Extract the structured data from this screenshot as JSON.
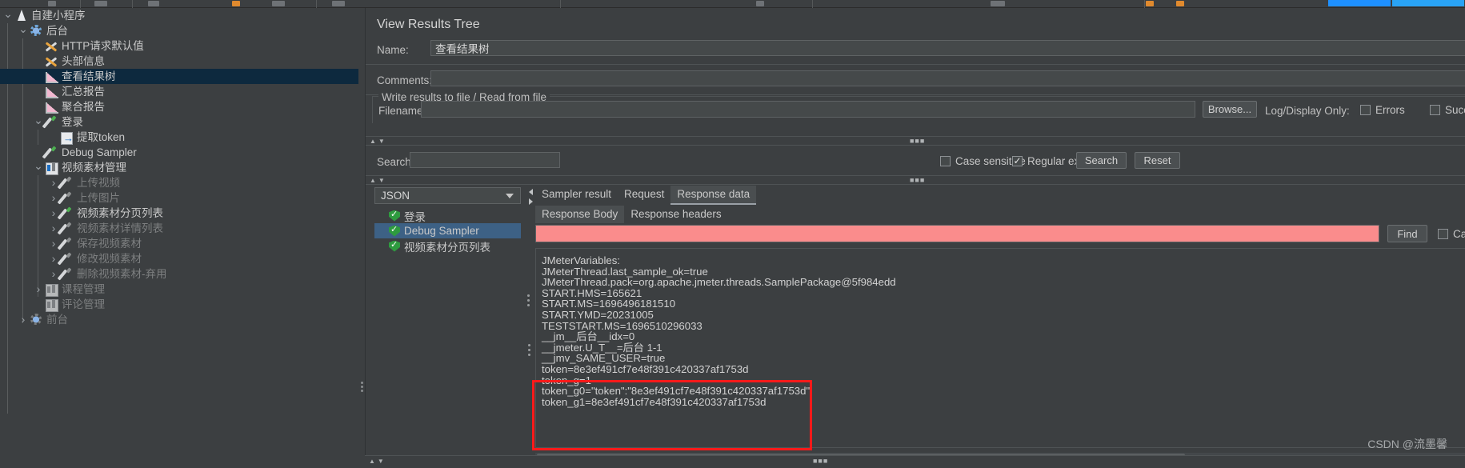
{
  "app": {
    "watermark": "CSDN @流墨馨"
  },
  "tree": {
    "items": [
      {
        "label": "自建小程序",
        "icon": "flask-icon",
        "depth": 0,
        "twisty": "open",
        "selected": false,
        "disabled": false
      },
      {
        "label": "后台",
        "icon": "gear-icon",
        "depth": 1,
        "twisty": "open",
        "selected": false,
        "disabled": false
      },
      {
        "label": "HTTP请求默认值",
        "icon": "wrench-icon",
        "depth": 2,
        "twisty": "none",
        "selected": false,
        "disabled": false
      },
      {
        "label": "头部信息",
        "icon": "wrench-icon",
        "depth": 2,
        "twisty": "none",
        "selected": false,
        "disabled": false
      },
      {
        "label": "查看结果树",
        "icon": "chart-icon",
        "depth": 2,
        "twisty": "none",
        "selected": true,
        "disabled": false
      },
      {
        "label": "汇总报告",
        "icon": "chart-icon",
        "depth": 2,
        "twisty": "none",
        "selected": false,
        "disabled": false
      },
      {
        "label": "聚合报告",
        "icon": "chart-icon",
        "depth": 2,
        "twisty": "none",
        "selected": false,
        "disabled": false
      },
      {
        "label": "登录",
        "icon": "sampler-pen-icon",
        "depth": 2,
        "twisty": "open",
        "selected": false,
        "disabled": false
      },
      {
        "label": "提取token",
        "icon": "post-processor-icon",
        "depth": 3,
        "twisty": "none",
        "selected": false,
        "disabled": false
      },
      {
        "label": "Debug Sampler",
        "icon": "sampler-pen-icon",
        "depth": 2,
        "twisty": "none",
        "selected": false,
        "disabled": false
      },
      {
        "label": "视频素材管理",
        "icon": "controller-icon",
        "depth": 2,
        "twisty": "open",
        "selected": false,
        "disabled": false
      },
      {
        "label": "上传视频",
        "icon": "sampler-pen-icon",
        "depth": 3,
        "twisty": "closed",
        "selected": false,
        "disabled": true
      },
      {
        "label": "上传图片",
        "icon": "sampler-pen-icon",
        "depth": 3,
        "twisty": "closed",
        "selected": false,
        "disabled": true
      },
      {
        "label": "视频素材分页列表",
        "icon": "sampler-pen-icon",
        "depth": 3,
        "twisty": "closed",
        "selected": false,
        "disabled": false
      },
      {
        "label": "视频素材详情列表",
        "icon": "sampler-pen-icon",
        "depth": 3,
        "twisty": "closed",
        "selected": false,
        "disabled": true
      },
      {
        "label": "保存视频素材",
        "icon": "sampler-pen-icon",
        "depth": 3,
        "twisty": "closed",
        "selected": false,
        "disabled": true
      },
      {
        "label": "修改视频素材",
        "icon": "sampler-pen-icon",
        "depth": 3,
        "twisty": "closed",
        "selected": false,
        "disabled": true
      },
      {
        "label": "删除视频素材-弃用",
        "icon": "sampler-pen-icon",
        "depth": 3,
        "twisty": "closed",
        "selected": false,
        "disabled": true
      },
      {
        "label": "课程管理",
        "icon": "controller-icon",
        "depth": 2,
        "twisty": "closed",
        "selected": false,
        "disabled": true
      },
      {
        "label": "评论管理",
        "icon": "controller-icon",
        "depth": 2,
        "twisty": "none",
        "selected": false,
        "disabled": true
      },
      {
        "label": "前台",
        "icon": "gear-icon",
        "depth": 1,
        "twisty": "closed",
        "selected": false,
        "disabled": true
      }
    ]
  },
  "panel": {
    "title": "View Results Tree",
    "name_label": "Name:",
    "name_value": "查看结果树",
    "comments_label": "Comments:",
    "comments_value": "",
    "file_group_legend": "Write results to file / Read from file",
    "filename_label": "Filename",
    "filename_value": "",
    "browse_label": "Browse...",
    "log_display_label": "Log/Display Only:",
    "errors_label": "Errors",
    "errors_checked": false,
    "successes_label": "Successes",
    "successes_checked": false
  },
  "search_bar": {
    "label": "Search:",
    "value": "",
    "case_sensitive_label": "Case sensitive",
    "case_sensitive_checked": false,
    "regular_exp_label": "Regular exp.",
    "regular_exp_checked": true,
    "search_button": "Search",
    "reset_button": "Reset"
  },
  "renderer": {
    "selected": "JSON"
  },
  "results": [
    {
      "label": "登录",
      "selected": false
    },
    {
      "label": "Debug Sampler",
      "selected": true
    },
    {
      "label": "视频素材分页列表",
      "selected": false
    }
  ],
  "tabs": {
    "main": [
      {
        "label": "Sampler result",
        "active": false
      },
      {
        "label": "Request",
        "active": false
      },
      {
        "label": "Response data",
        "active": true
      }
    ],
    "sub": [
      {
        "label": "Response Body",
        "active": true
      },
      {
        "label": "Response headers",
        "active": false
      }
    ]
  },
  "find_bar": {
    "value": "",
    "find_button": "Find",
    "case_sensitive_label": "Case sensitive",
    "case_sensitive_checked": false,
    "highlight_color": "#fa8c8c"
  },
  "response_body": {
    "lines": [
      "JMeterVariables:",
      "JMeterThread.last_sample_ok=true",
      "JMeterThread.pack=org.apache.jmeter.threads.SamplePackage@5f984edd",
      "START.HMS=165621",
      "START.MS=1696496181510",
      "START.YMD=20231005",
      "TESTSTART.MS=1696510296033",
      "__jm__后台__idx=0",
      "__jmeter.U_T__=后台 1-1",
      "__jmv_SAME_USER=true"
    ],
    "highlighted_lines": [
      "token=8e3ef491cf7e48f391c420337af1753d",
      "token_g=1",
      "token_g0=\"token\":\"8e3ef491cf7e48f391c420337af1753d\"",
      "token_g1=8e3ef491cf7e48f391c420337af1753d"
    ],
    "highlight_box_color": "#ff1a1a"
  }
}
